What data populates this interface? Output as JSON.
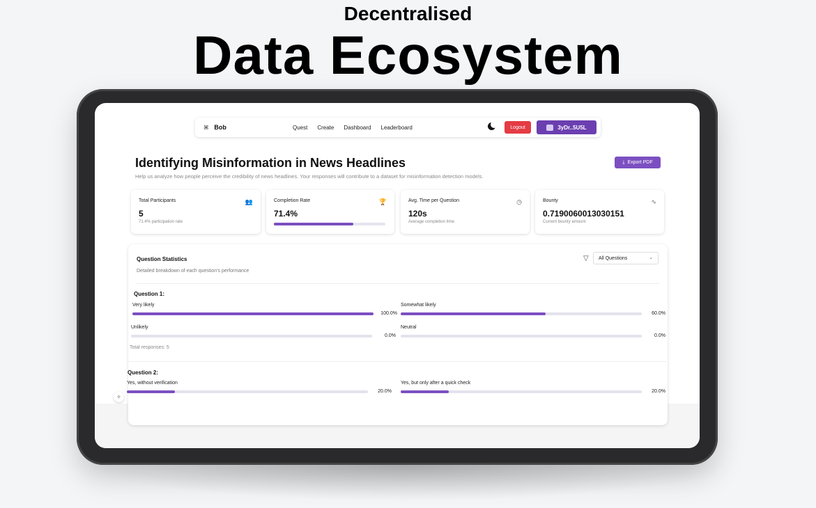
{
  "hero": {
    "subtitle": "Decentralised",
    "title": "Data Ecosystem"
  },
  "nav": {
    "brand": "Bob",
    "links": [
      "Quest",
      "Create",
      "Dashboard",
      "Leaderboard"
    ],
    "logout": "Logout",
    "wallet": "3yDr..5U5L"
  },
  "page": {
    "title": "Identifying Misinformation in News Headlines",
    "description": "Help us analyze how people perceive the credibility of news headlines. Your responses will contribute to a dataset for misinformation detection models.",
    "export": "Export PDF"
  },
  "cards": [
    {
      "label": "Total Participants",
      "value": "5",
      "sub": "71.4% participation rate",
      "icon": "users-icon"
    },
    {
      "label": "Completion Rate",
      "value": "71.4%",
      "progress": 0.714,
      "icon": "trophy-icon"
    },
    {
      "label": "Avg. Time per Question",
      "value": "120s",
      "sub": "Average completion time",
      "icon": "clock-icon"
    },
    {
      "label": "Bounty",
      "value": "0.7190060013030151",
      "sub": "Current bounty amount",
      "icon": "activity-icon"
    }
  ],
  "stats": {
    "title": "Question Statistics",
    "description": "Detailed breakdown of each question's performance",
    "filter": "All Questions",
    "questions": [
      {
        "title": "Question 1:",
        "options": [
          {
            "label": "Very likely",
            "pct": "100.0%",
            "value": 1.0
          },
          {
            "label": "Somewhat likely",
            "pct": "60.0%",
            "value": 0.6
          },
          {
            "label": "Unlikely",
            "pct": "0.0%",
            "value": 0.0
          },
          {
            "label": "Neutral",
            "pct": "0.0%",
            "value": 0.0
          }
        ],
        "total": "Total responses: 5"
      },
      {
        "title": "Question 2:",
        "options": [
          {
            "label": "Yes, without verification",
            "pct": "20.0%",
            "value": 0.2
          },
          {
            "label": "Yes, but only after a quick check",
            "pct": "20.0%",
            "value": 0.2
          }
        ]
      }
    ]
  }
}
